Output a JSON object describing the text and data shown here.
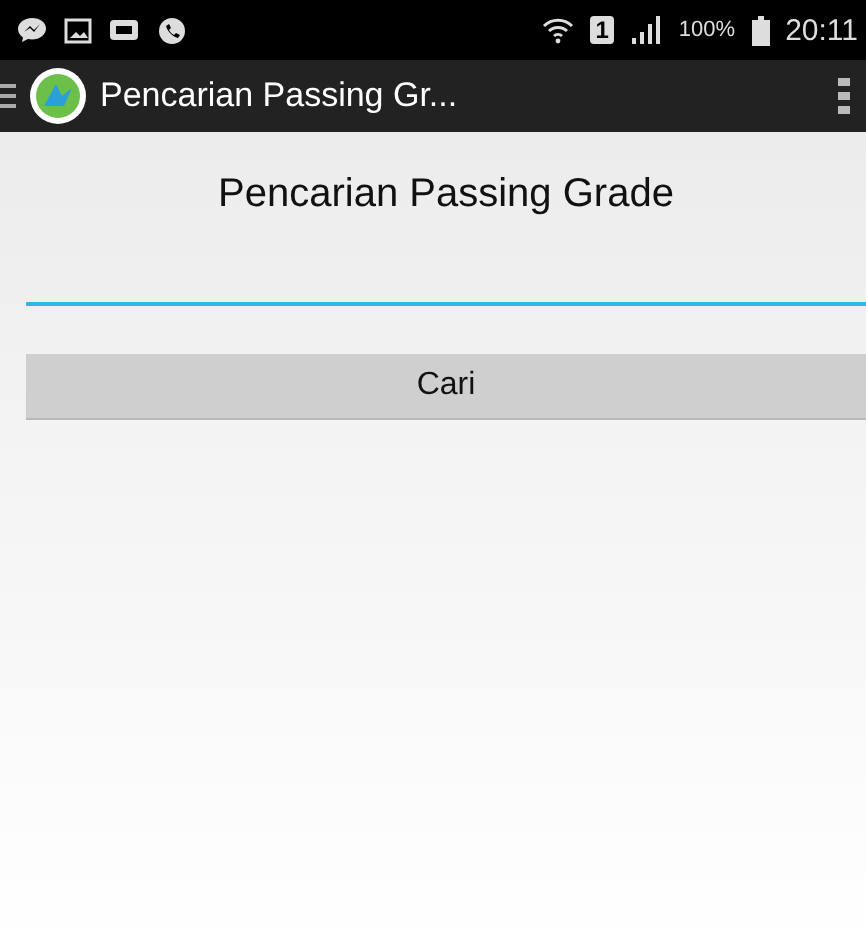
{
  "status_bar": {
    "sim_slot": "1",
    "battery": "100%",
    "time": "20:11"
  },
  "app_bar": {
    "title": "Pencarian Passing Gr..."
  },
  "heading": "Pencarian Passing Grade",
  "search_field": {
    "focused": true
  },
  "buttons": [
    "Cari"
  ]
}
